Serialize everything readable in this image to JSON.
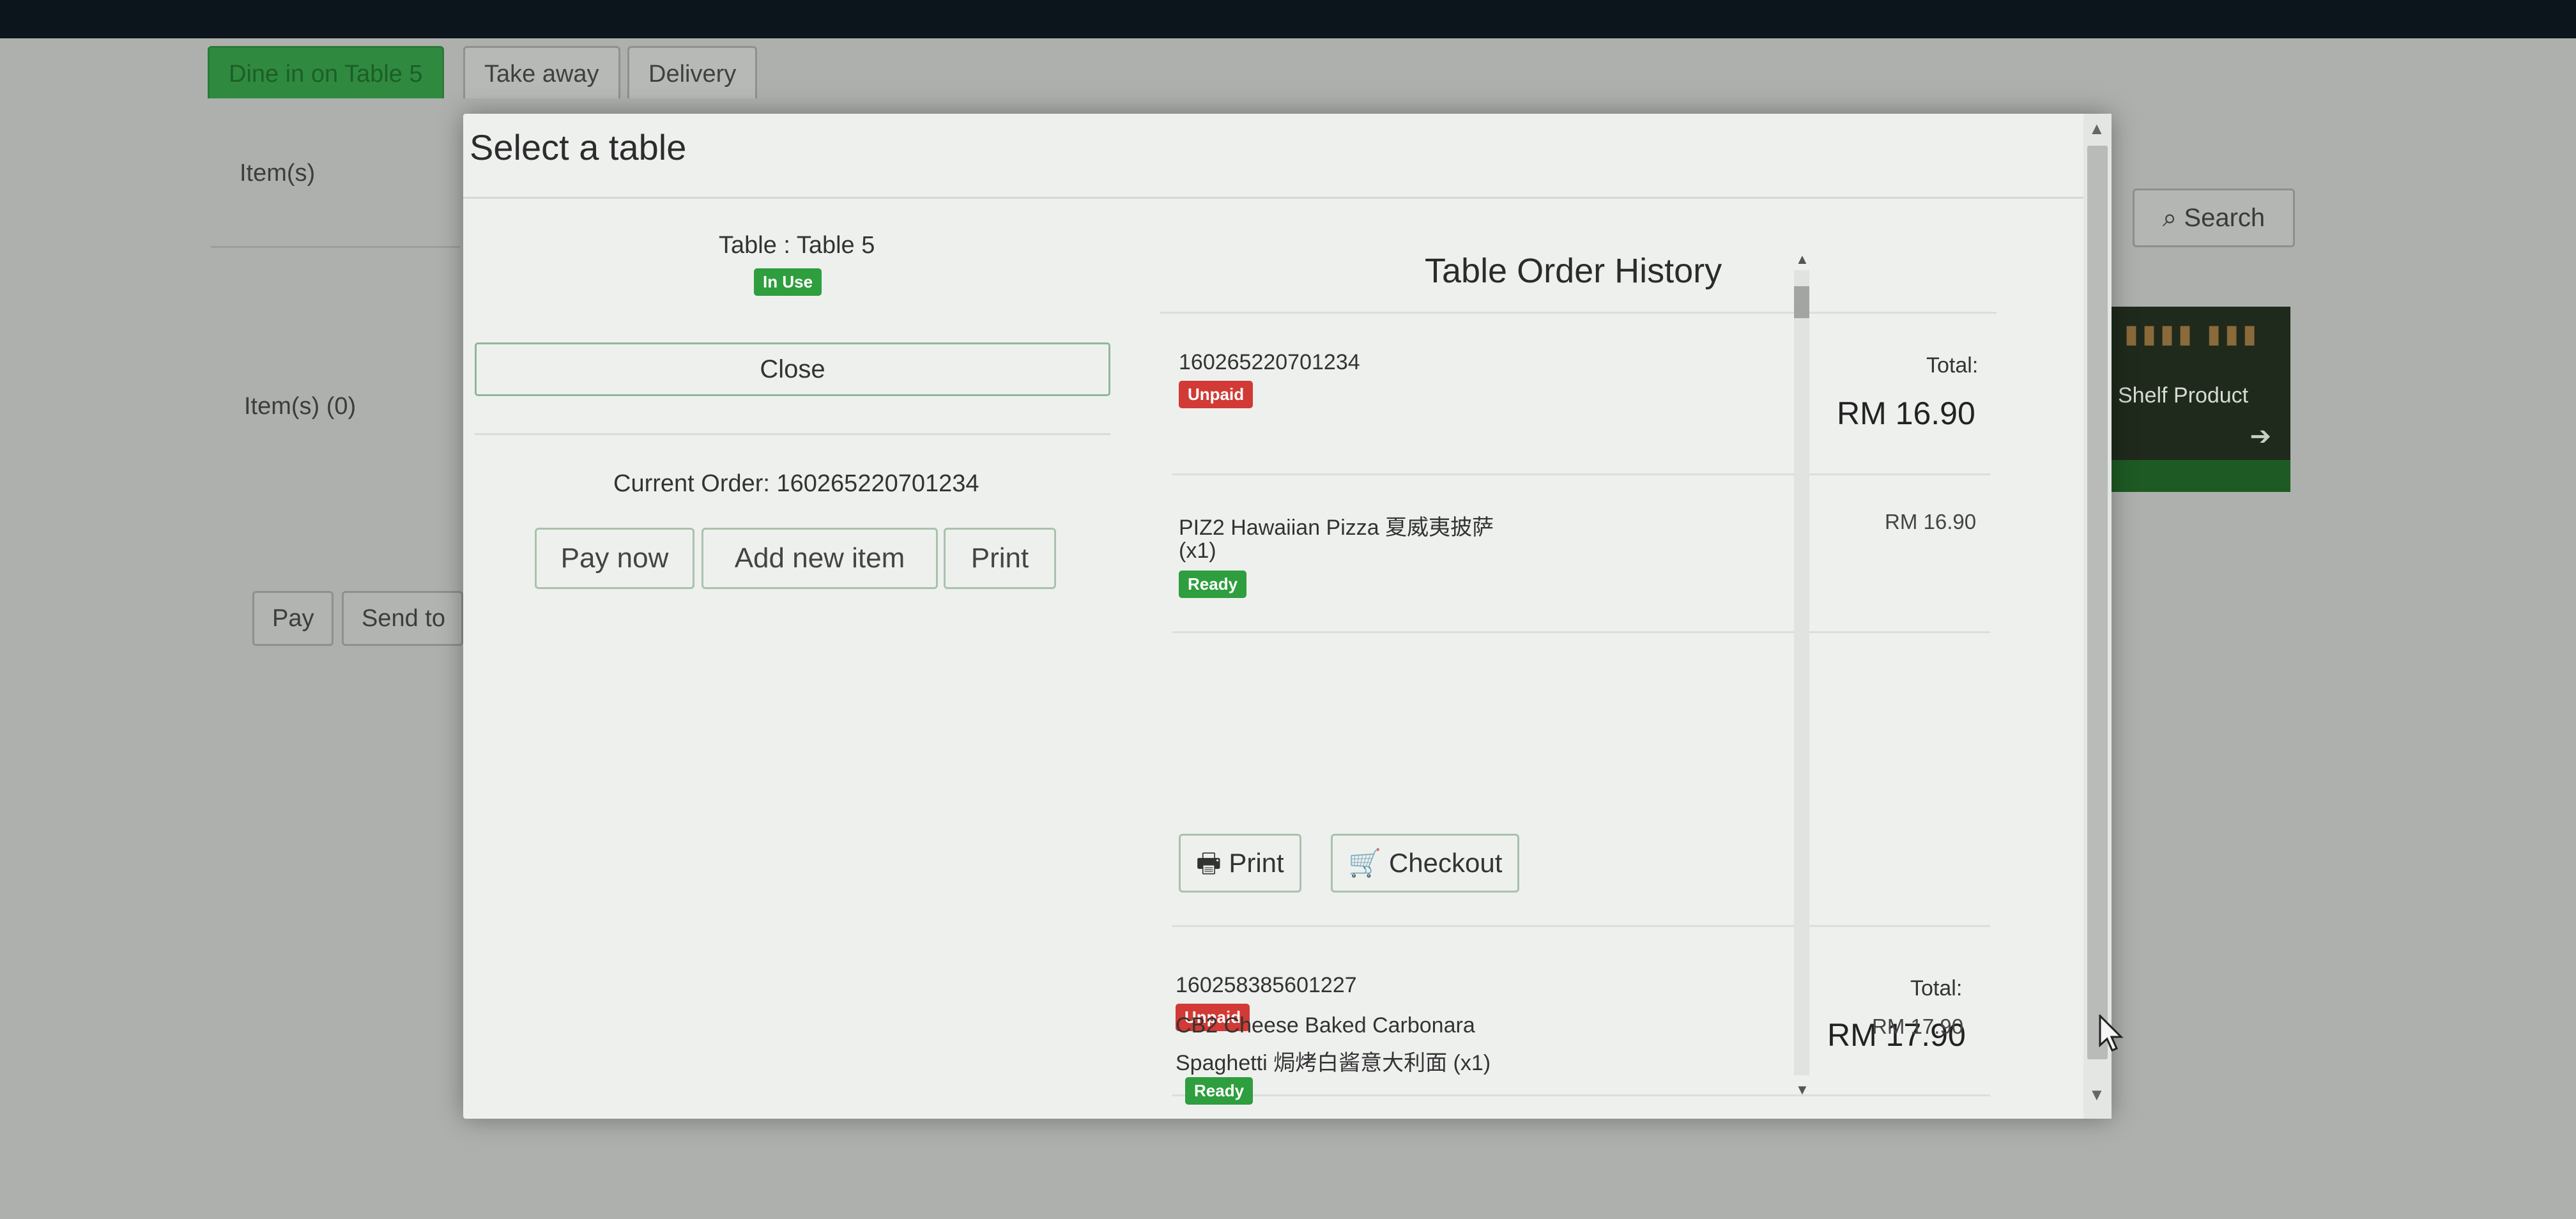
{
  "background_app": {
    "tabs": [
      "Dine in on Table 5",
      "Take away",
      "Delivery"
    ],
    "items_label": "Item(s)",
    "items_count_label": "Item(s) (0)",
    "pay_button": "Pay",
    "send_button": "Send to",
    "search_button": "Search",
    "product_tile": "Shelf Product"
  },
  "modal": {
    "title": "Select a table",
    "table_name": "Table : Table 5",
    "table_status": "In Use",
    "close_button": "Close",
    "current_order": "Current Order: 160265220701234",
    "actions": {
      "pay_now": "Pay now",
      "add_new_item": "Add new item",
      "print": "Print"
    }
  },
  "history": {
    "title": "Table Order History",
    "total_label": "Total:",
    "print_button": "Print",
    "checkout_button": "Checkout",
    "orders": [
      {
        "id": "160265220701234",
        "status": "Unpaid",
        "total": "RM 16.90",
        "item_line1": "PIZ2 Hawaiian Pizza 夏威夷披萨",
        "item_line2": "(x1)",
        "item_status": "Ready",
        "item_price": "RM 16.90"
      },
      {
        "id": "160258385601227",
        "status": "Unpaid",
        "total": "RM 17.90",
        "item_line1": "CB2 Cheese Baked Carbonara",
        "item_line2": "Spaghetti 焗烤白酱意大利面 (x1)",
        "item_status": "Ready",
        "item_price": "RM 17.90"
      }
    ]
  },
  "colors": {
    "success": "#2e9e3e",
    "danger": "#d13a35",
    "modal_bg": "#eef0ee"
  }
}
